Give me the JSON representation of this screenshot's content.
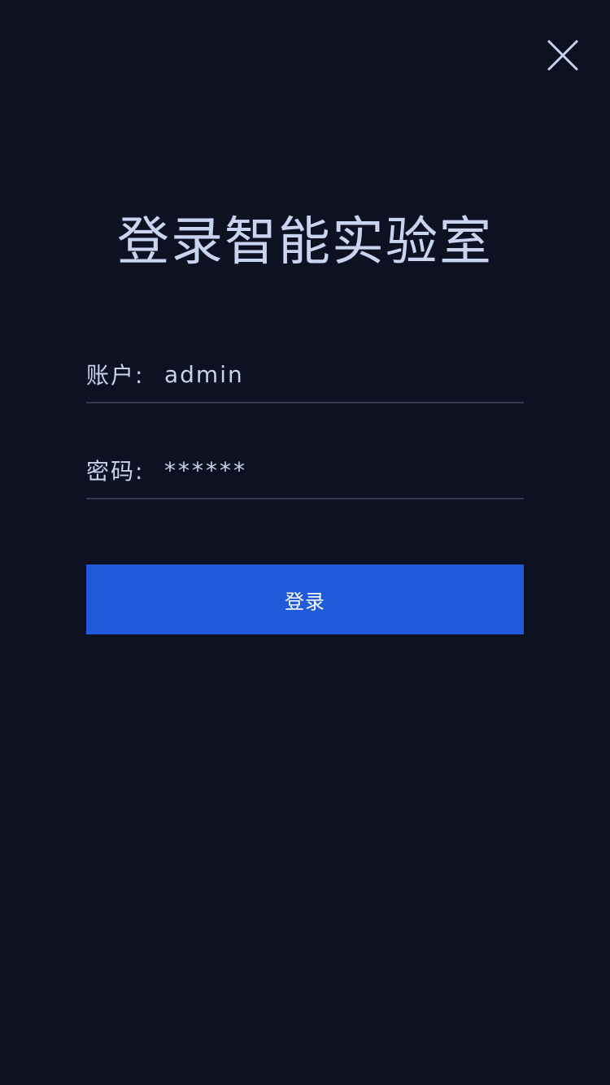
{
  "header": {
    "close_icon": "close-icon"
  },
  "title": "登录智能实验室",
  "form": {
    "account": {
      "label": "账户:",
      "value": "admin"
    },
    "password": {
      "label": "密码:",
      "value": "******"
    },
    "login_label": "登录"
  },
  "colors": {
    "background": "#0e1122",
    "text": "#c7d2ef",
    "accent": "#215ad9",
    "divider": "#343a52"
  }
}
